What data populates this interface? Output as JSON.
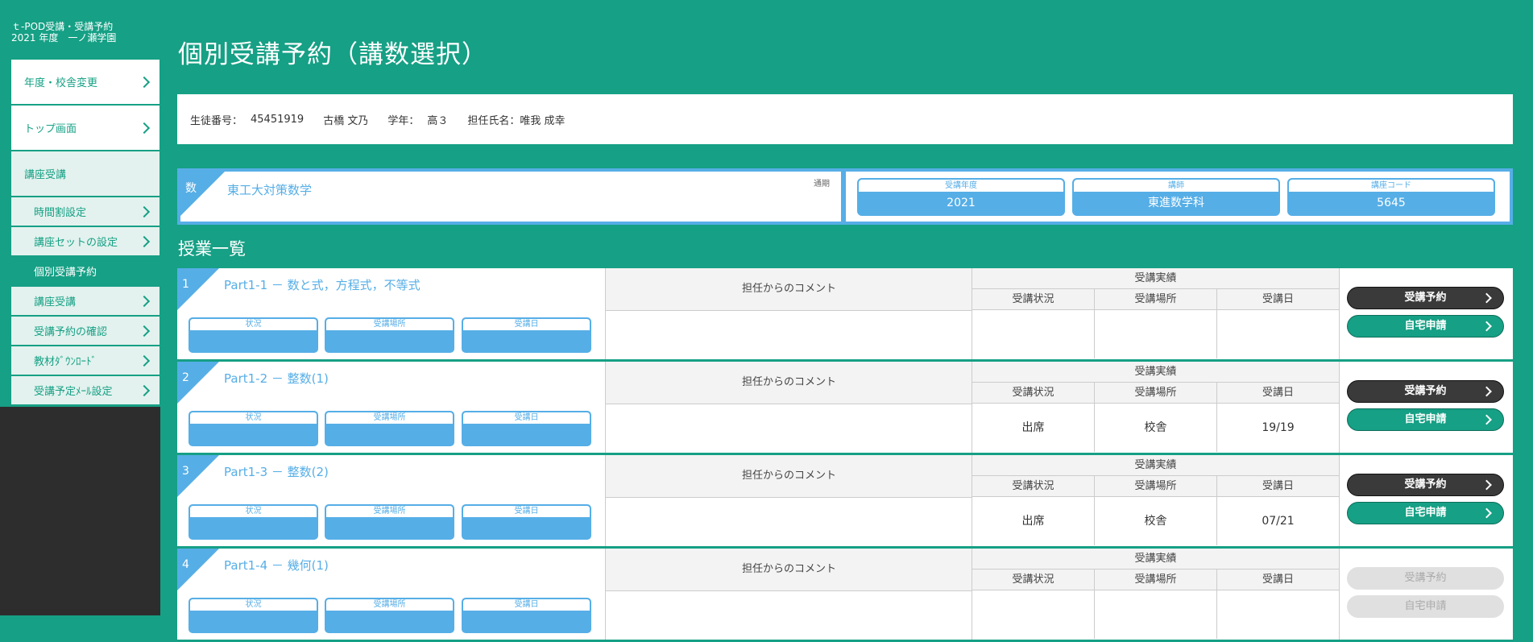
{
  "sidebar": {
    "title_line1": "ｔ-POD受講・受講予約",
    "title_line2": "2021 年度　一ノ瀬学園",
    "items": [
      {
        "label": "年度・校舎変更"
      },
      {
        "label": "トップ画面"
      },
      {
        "label": "講座受講"
      },
      {
        "label": "時間割設定"
      },
      {
        "label": "講座セットの設定"
      },
      {
        "label": "個別受講予約"
      },
      {
        "label": "講座受講"
      },
      {
        "label": "受講予約の確認"
      },
      {
        "label": "教材ﾀﾞｳﾝﾛｰﾄﾞ"
      },
      {
        "label": "受講予定ﾒｰﾙ設定"
      }
    ]
  },
  "page_title": "個別受講予約（講数選択）",
  "student": {
    "id_label": "生徒番号：",
    "id": "45451919",
    "name": "古橋 文乃",
    "grade_label": "学年：",
    "grade": "高３",
    "teacher_label": "担任氏名：",
    "teacher": "唯我 成幸"
  },
  "course": {
    "subject": "数",
    "name": "東工大対策数学",
    "term": "通期",
    "year_label": "受講年度",
    "year": "2021",
    "instructor_label": "講師",
    "instructor": "東進数学科",
    "code_label": "講座コード",
    "code": "5645"
  },
  "section_title": "授業一覧",
  "labels": {
    "status": "状況",
    "place": "受講場所",
    "date": "受講日",
    "comment_header": "担任からのコメント",
    "record_header": "受講実績",
    "rec_status": "受講状況",
    "rec_place": "受講場所",
    "rec_date": "受講日",
    "reserve_btn": "受講予約",
    "home_btn": "自宅申請"
  },
  "lessons": [
    {
      "num": "1",
      "title": "Part1-1 － 数と式，方程式，不等式",
      "rec_status": "",
      "rec_place": "",
      "rec_date": ""
    },
    {
      "num": "2",
      "title": "Part1-2 － 整数(1)",
      "rec_status": "出席",
      "rec_place": "校舎",
      "rec_date": "19/19"
    },
    {
      "num": "3",
      "title": "Part1-3 － 整数(2)",
      "rec_status": "出席",
      "rec_place": "校舎",
      "rec_date": "07/21"
    },
    {
      "num": "4",
      "title": "Part1-4 － 幾何(1)",
      "rec_status": "",
      "rec_place": "",
      "rec_date": ""
    }
  ]
}
